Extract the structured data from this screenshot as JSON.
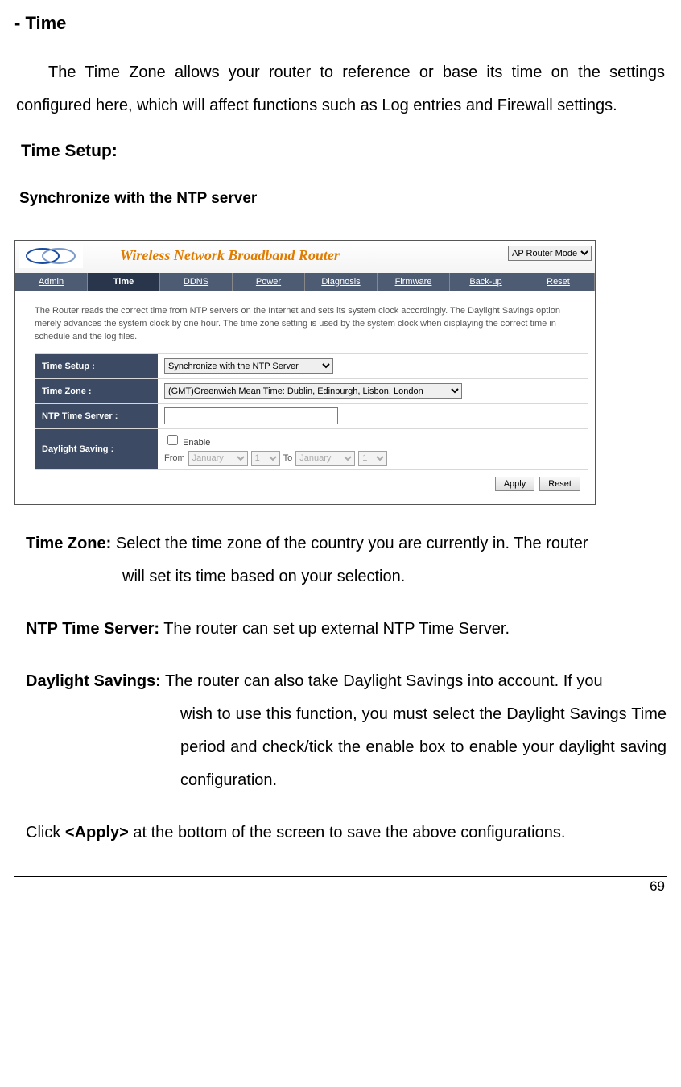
{
  "doc": {
    "title": "- Time",
    "intro": "The Time Zone allows your router to reference or base its time on the settings configured here, which will affect functions such as Log entries and Firewall settings.",
    "subheading": "Time Setup:",
    "syncHeading": "Synchronize with the NTP server"
  },
  "screenshot": {
    "productTitle": "Wireless Network Broadband Router",
    "modeSelected": "AP Router Mode",
    "tabs": [
      "Admin",
      "Time",
      "DDNS",
      "Power",
      "Diagnosis",
      "Firmware",
      "Back-up",
      "Reset"
    ],
    "activeTab": "Time",
    "description": "The Router reads the correct time from NTP servers on the Internet and sets its system clock accordingly. The Daylight Savings option merely advances the system clock by one hour. The time zone setting is used by the system clock when displaying the correct time in schedule and the log files.",
    "labels": {
      "timeSetup": "Time Setup :",
      "timeZone": "Time Zone :",
      "ntpServer": "NTP Time Server :",
      "daylight": "Daylight Saving :"
    },
    "fields": {
      "timeSetupValue": "Synchronize with the NTP Server",
      "timeZoneValue": "(GMT)Greenwich Mean Time: Dublin, Edinburgh, Lisbon, London",
      "ntpServerValue": "",
      "enableLabel": "Enable",
      "fromLabel": "From",
      "toLabel": "To",
      "monthFrom": "January",
      "dayFrom": "1",
      "monthTo": "January",
      "dayTo": "1"
    },
    "buttons": {
      "apply": "Apply",
      "reset": "Reset"
    }
  },
  "defs": {
    "tzLabel": "Time Zone:",
    "tzText1": " Select the time zone of the country you are currently in. The router",
    "tzText2": "will set its time based on your selection.",
    "ntpLabel": "NTP Time Server:",
    "ntpText": " The router can set up external NTP Time Server.",
    "dsLabel": "Daylight Savings:",
    "dsText1": " The router can also take Daylight Savings into account. If you",
    "dsText2": "wish to use this function, you must select the Daylight Savings Time period and check/tick the enable box to enable your daylight saving configuration."
  },
  "applyLine": {
    "pre": "Click ",
    "bold": "<Apply>",
    "post": " at the bottom of the screen to save the above configurations."
  },
  "pageNumber": "69"
}
